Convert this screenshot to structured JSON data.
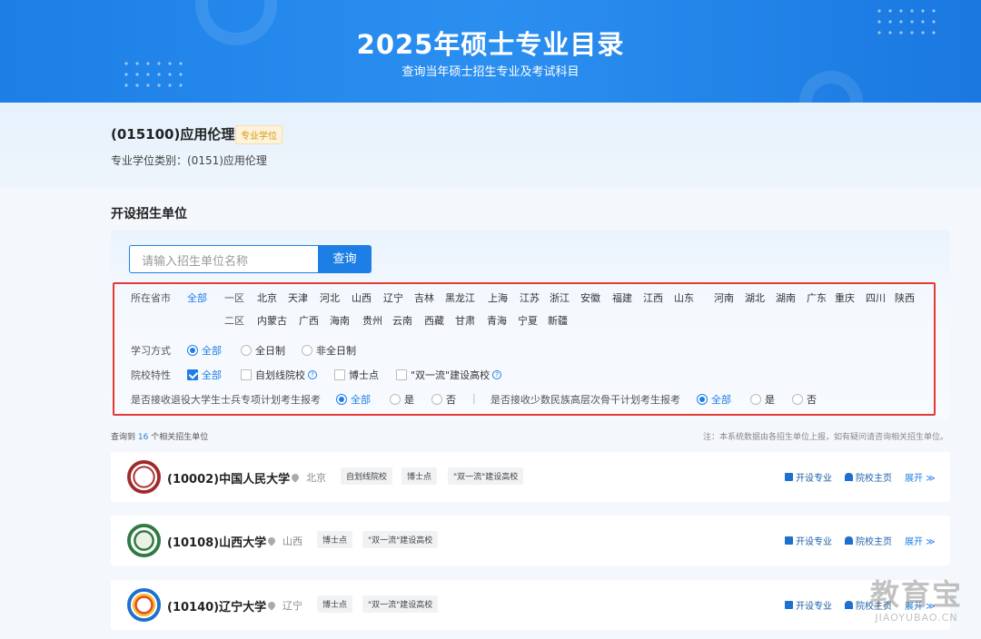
{
  "banner": {
    "title": "2025年硕士专业目录",
    "subtitle": "查询当年硕士招生专业及考试科目"
  },
  "major": {
    "name": "(015100)应用伦理",
    "tag": "专业学位",
    "category": "专业学位类别：(0151)应用伦理"
  },
  "section_title": "开设招生单位",
  "search": {
    "placeholder": "请输入招生单位名称",
    "button": "查询"
  },
  "filters": {
    "province_label": "所在省市",
    "all": "全部",
    "zone1_label": "一区",
    "zone1": [
      "北京",
      "天津",
      "河北",
      "山西",
      "辽宁",
      "吉林",
      "黑龙江",
      "上海",
      "江苏",
      "浙江",
      "安徽",
      "福建",
      "江西",
      "山东",
      "河南",
      "湖北",
      "湖南",
      "广东",
      "重庆",
      "四川",
      "陕西"
    ],
    "zone2_label": "二区",
    "zone2": [
      "内蒙古",
      "广西",
      "海南",
      "贵州",
      "云南",
      "西藏",
      "甘肃",
      "青海",
      "宁夏",
      "新疆"
    ],
    "study_label": "学习方式",
    "study_options": [
      "全部",
      "全日制",
      "非全日制"
    ],
    "school_label": "院校特性",
    "school_options": [
      "全部",
      "自划线院校",
      "博士点",
      "\"双一流\"建设高校"
    ],
    "retired_label": "是否接收退役大学生士兵专项计划考生报考",
    "minority_label": "是否接收少数民族高层次骨干计划考生报考",
    "yesno_options": [
      "全部",
      "是",
      "否"
    ],
    "separator": "|"
  },
  "results": {
    "prefix": "查询到",
    "count": "16",
    "suffix": "个相关招生单位",
    "note": "注：本系统数据由各招生单位上报，如有疑问请咨询相关招生单位。"
  },
  "actions": {
    "majors": "开设专业",
    "home": "院校主页",
    "expand": "展开 ≫"
  },
  "universities": [
    {
      "name": "(10002)中国人民大学",
      "location": "北京",
      "tags": [
        "自划线院校",
        "博士点",
        "\"双一流\"建设高校"
      ]
    },
    {
      "name": "(10108)山西大学",
      "location": "山西",
      "tags": [
        "博士点",
        "\"双一流\"建设高校"
      ]
    },
    {
      "name": "(10140)辽宁大学",
      "location": "辽宁",
      "tags": [
        "博士点",
        "\"双一流\"建设高校"
      ]
    }
  ],
  "watermark": {
    "line1": "教育宝",
    "line2": "JIAOYUBAO.CN"
  },
  "colors": {
    "accent": "#1d7fe6",
    "highlight_box": "#e53935",
    "tag_text": "#d69a12"
  }
}
